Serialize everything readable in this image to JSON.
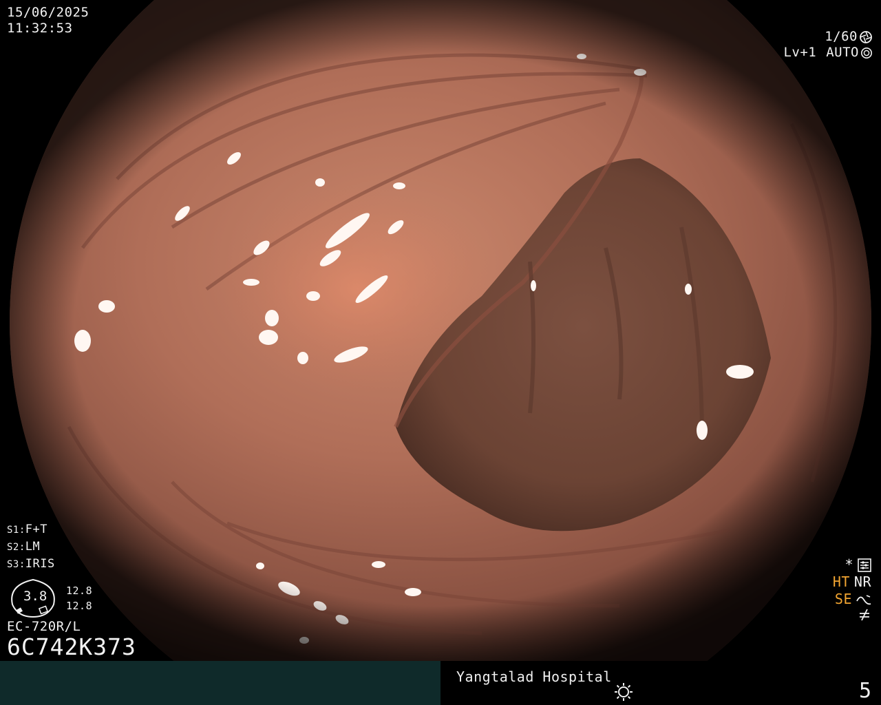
{
  "overlay": {
    "date": "15/06/2025",
    "time": "11:32:53",
    "shutter_speed": "1/60",
    "shutter_icon": "aperture-icon",
    "level": "Lv+1",
    "exposure_mode": "AUTO",
    "exposure_icon": "auto-exposure-icon",
    "modes": [
      {
        "key": "S1:",
        "value": "F+T"
      },
      {
        "key": "S2:",
        "value": "LM"
      },
      {
        "key": "S3:",
        "value": "IRIS"
      }
    ],
    "gauge_value": "3.8",
    "gauge_values": [
      "12.8",
      "12.8"
    ],
    "scope_model": "EC-720R/L",
    "serial": "6C742K373",
    "status": {
      "star": "*",
      "star_icon": "settings-icon",
      "ht": "HT",
      "nr": "NR",
      "se": "SE",
      "se_icon": "enhancement-curve-icon",
      "freeze_icon": "not-equal-icon"
    },
    "hospital": "Yangtalad Hospital",
    "light_icon": "light-source-icon",
    "frame_number": "5"
  },
  "colors": {
    "bottom_left_panel": "#0f2a2a",
    "amber_label": "#f2a531",
    "mucosa": "#b8735e"
  }
}
